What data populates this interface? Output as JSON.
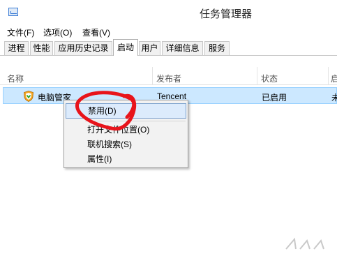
{
  "window": {
    "title": "任务管理器",
    "icon": "task-manager-icon"
  },
  "menubar": [
    "文件(F)",
    "选项(O)",
    "查看(V)"
  ],
  "tabs": [
    "进程",
    "性能",
    "应用历史记录",
    "启动",
    "用户",
    "详细信息",
    "服务"
  ],
  "active_tab": "启动",
  "columns": [
    "名称",
    "发布者",
    "状态",
    "启"
  ],
  "rows": [
    {
      "name": "电脑管家",
      "publisher": "Tencent",
      "status": "已启用",
      "impact": "未"
    }
  ],
  "context_menu": {
    "items": [
      "禁用(D)",
      "打开文件位置(O)",
      "联机搜索(S)",
      "属性(I)"
    ],
    "highlighted": "禁用(D)"
  },
  "colors": {
    "selection": "#cce8ff",
    "selection_border": "#99d1ff",
    "menu_highlight": "#dcebfc",
    "annotation": "#e8141b"
  }
}
